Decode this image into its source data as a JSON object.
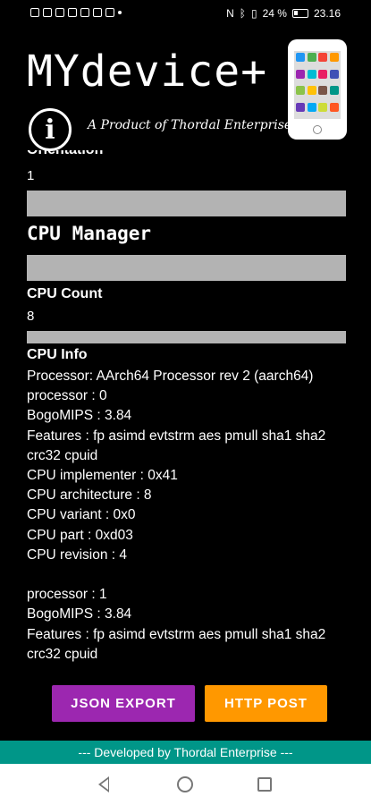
{
  "status_bar": {
    "battery": "24 %",
    "time": "23.16",
    "left_icons": [
      "signal-icon",
      "wifi-icon",
      "sim-icon",
      "image-icon",
      "doc-icon",
      "bag-icon",
      "gear-icon",
      "dot-icon"
    ],
    "right_icons": [
      "nfc-icon",
      "bluetooth-icon",
      "vibrate-icon",
      "battery-icon"
    ]
  },
  "header": {
    "title": "MYdevice+",
    "tagline": "A Product of Thordal Enterprise",
    "info_icon_glyph": "i"
  },
  "content": {
    "orientation_label": "Orientation",
    "orientation_value": "1",
    "cpu_manager_title": "CPU Manager",
    "cpu_count_label": "CPU Count",
    "cpu_count_value": "8",
    "cpu_info_label": "CPU Info",
    "cpu_info_text": "Processor: AArch64 Processor rev 2 (aarch64)\nprocessor : 0\nBogoMIPS : 3.84\nFeatures : fp asimd evtstrm aes pmull sha1 sha2 crc32 cpuid\nCPU implementer : 0x41\nCPU architecture : 8\nCPU variant : 0x0\nCPU part : 0xd03\nCPU revision : 4\n\nprocessor : 1\nBogoMIPS : 3.84\nFeatures : fp asimd evtstrm aes pmull sha1 sha2 crc32 cpuid"
  },
  "buttons": {
    "json_export": "JSON EXPORT",
    "http_post": "HTTP POST"
  },
  "footer": {
    "text": "--- Developed by Thordal Enterprise ---"
  },
  "colors": {
    "json_button": "#9c27b0",
    "http_button": "#ff9800",
    "footer": "#009688",
    "divider": "#b3b3b3"
  }
}
